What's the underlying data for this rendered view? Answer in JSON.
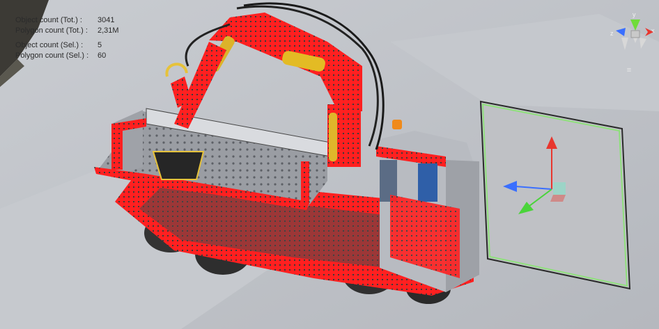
{
  "stats": {
    "object_count_tot_label": "Object count (Tot.) :",
    "object_count_tot_value": "3041",
    "polygon_count_tot_label": "Polygon count (Tot.) :",
    "polygon_count_tot_value": "2,31M",
    "object_count_sel_label": "Object count (Sel.) :",
    "object_count_sel_value": "5",
    "polygon_count_sel_label": "Polygon count (Sel.) :",
    "polygon_count_sel_value": "60"
  },
  "gizmo": {
    "x_label": "x",
    "y_label": "y",
    "z_label": "z"
  },
  "colors": {
    "selection_highlight": "#ff1a1a",
    "axis_x": "#e8362e",
    "axis_y": "#7ee23b",
    "axis_z": "#3a6fff",
    "plane_outline": "#8fe07c",
    "background": "#b9bcc2"
  },
  "icons": {
    "view_gizmo": "orientation-gizmo-icon",
    "gizmo_menu": "hamburger-menu-icon",
    "transform_gizmo": "move-transform-icon"
  }
}
